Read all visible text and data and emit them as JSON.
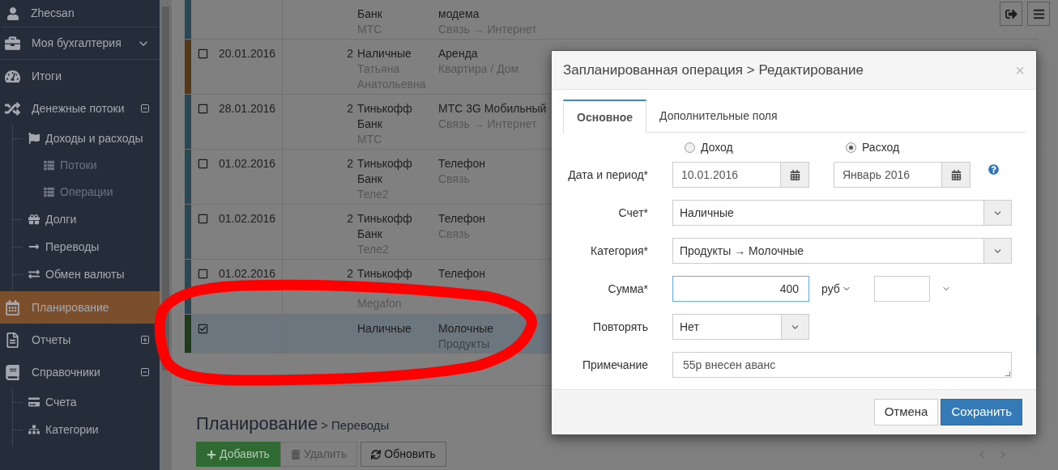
{
  "sidebar": {
    "user": "Zhecsan",
    "items": [
      {
        "label": "Моя бухгалтерия",
        "kind": "dropdown",
        "selected": false
      },
      {
        "label": "Итоги",
        "kind": "link",
        "selected": false
      },
      {
        "label": "Денежные потоки",
        "kind": "group",
        "expanded": true,
        "selected": false,
        "children": [
          {
            "label": "Доходы и расходы",
            "selected": false,
            "children": [
              {
                "label": "Потоки",
                "selected": false
              },
              {
                "label": "Операции",
                "selected": false
              }
            ]
          },
          {
            "label": "Долги",
            "selected": false
          },
          {
            "label": "Переводы",
            "selected": false
          },
          {
            "label": "Обмен валюты",
            "selected": false
          }
        ]
      },
      {
        "label": "Планирование",
        "kind": "link",
        "selected": true
      },
      {
        "label": "Отчеты",
        "kind": "group",
        "expanded": false,
        "selected": false
      },
      {
        "label": "Справочники",
        "kind": "group",
        "expanded": true,
        "selected": false,
        "children": [
          {
            "label": "Счета",
            "selected": false
          },
          {
            "label": "Категории",
            "selected": false
          }
        ]
      }
    ]
  },
  "table": {
    "rows": [
      {
        "color": "#2b4753",
        "selected": false,
        "account": "Банк",
        "payee": "МТС",
        "category": "модема",
        "subcategory": "Связь → Интернет"
      },
      {
        "color": "#53391a",
        "selected": false,
        "checked": false,
        "date": "20.01.2016",
        "qty": "2",
        "account": "Наличные",
        "payee": "Татьяна Анатольевна",
        "category": "Аренда",
        "subcategory": "Квартира / Дом"
      },
      {
        "color": "#2b4753",
        "selected": false,
        "checked": false,
        "date": "28.01.2016",
        "qty": "2",
        "account": "Тинькофф Банк",
        "payee": "МТС",
        "category": "МТС 3G Мобильный",
        "subcategory": "Связь → Интернет"
      },
      {
        "color": "#2b4753",
        "selected": false,
        "checked": false,
        "date": "01.02.2016",
        "qty": "2",
        "account": "Тинькофф Банк",
        "payee": "Теле2",
        "category": "Телефон",
        "subcategory": "Связь"
      },
      {
        "color": "#2b4753",
        "selected": false,
        "checked": false,
        "date": "01.02.2016",
        "qty": "2",
        "account": "Тинькофф Банк",
        "payee": "Теле2",
        "category": "Телефон",
        "subcategory": "Связь"
      },
      {
        "color": "#2b4753",
        "selected": false,
        "checked": false,
        "date": "01.02.2016",
        "qty": "2",
        "account": "Тинькофф",
        "payee": "Megafon",
        "category": "Телефон"
      },
      {
        "color": "#1f3a1c",
        "selected": true,
        "checked": true,
        "account": "Наличные",
        "category": "Молочные",
        "subcategory": "Продукты"
      }
    ]
  },
  "page": {
    "title": "Планирование",
    "subtitle": "> Переводы"
  },
  "toolbar": [
    {
      "label": "Добавить",
      "kind": "add",
      "disabled": false
    },
    {
      "label": "Удалить",
      "kind": "delete",
      "disabled": true
    },
    {
      "label": "Обновить",
      "kind": "refresh",
      "disabled": false
    }
  ],
  "dialog": {
    "title": "Запланированная операция > Редактирование",
    "close": "×",
    "tabs": [
      {
        "label": "Основное",
        "selected": true
      },
      {
        "label": "Дополнительные поля",
        "selected": false
      }
    ],
    "type_options": [
      {
        "label": "Доход",
        "selected": false
      },
      {
        "label": "Расход",
        "selected": true
      }
    ],
    "fields": [
      {
        "kind": "date_period",
        "label": "Дата и период*",
        "date": "10.01.2016",
        "period": "Январь 2016"
      },
      {
        "kind": "select",
        "label": "Счет*",
        "value": "Наличные"
      },
      {
        "kind": "select",
        "label": "Категория*",
        "value": "Продукты → Молочные"
      },
      {
        "kind": "amount",
        "label": "Сумма*",
        "value": "400",
        "currency": "руб",
        "focused": true
      },
      {
        "kind": "select_short",
        "label": "Повторять",
        "value": "Нет"
      },
      {
        "kind": "textarea",
        "label": "Примечание",
        "value": "55р внесен аванс"
      }
    ],
    "buttons": [
      {
        "label": "Отмена",
        "kind": "default"
      },
      {
        "label": "Сохранить",
        "kind": "primary"
      }
    ]
  }
}
